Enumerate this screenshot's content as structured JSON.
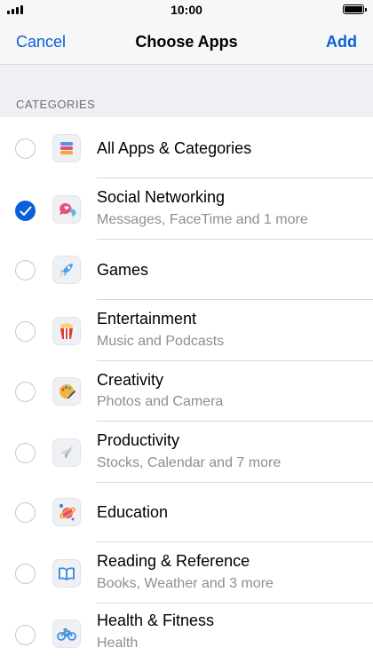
{
  "status_bar": {
    "time": "10:00"
  },
  "nav": {
    "cancel": "Cancel",
    "title": "Choose Apps",
    "add": "Add"
  },
  "section": {
    "header": "CATEGORIES"
  },
  "colors": {
    "accent": "#0a60d8",
    "subtitle": "#8e8e93",
    "group_bg": "#efeff4"
  },
  "categories": [
    {
      "title": "All Apps & Categories",
      "subtitle": "",
      "checked": false,
      "icon": "stack-icon"
    },
    {
      "title": "Social Networking",
      "subtitle": "Messages, FaceTime and 1 more",
      "checked": true,
      "icon": "chat-bubbles-icon"
    },
    {
      "title": "Games",
      "subtitle": "",
      "checked": false,
      "icon": "rocket-icon"
    },
    {
      "title": "Entertainment",
      "subtitle": "Music and Podcasts",
      "checked": false,
      "icon": "popcorn-icon"
    },
    {
      "title": "Creativity",
      "subtitle": "Photos and Camera",
      "checked": false,
      "icon": "palette-icon"
    },
    {
      "title": "Productivity",
      "subtitle": "Stocks, Calendar and 7 more",
      "checked": false,
      "icon": "paper-plane-icon"
    },
    {
      "title": "Education",
      "subtitle": "",
      "checked": false,
      "icon": "planet-icon"
    },
    {
      "title": "Reading & Reference",
      "subtitle": "Books, Weather and 3 more",
      "checked": false,
      "icon": "book-icon"
    },
    {
      "title": "Health & Fitness",
      "subtitle": "Health",
      "checked": false,
      "icon": "bicycle-icon"
    }
  ]
}
